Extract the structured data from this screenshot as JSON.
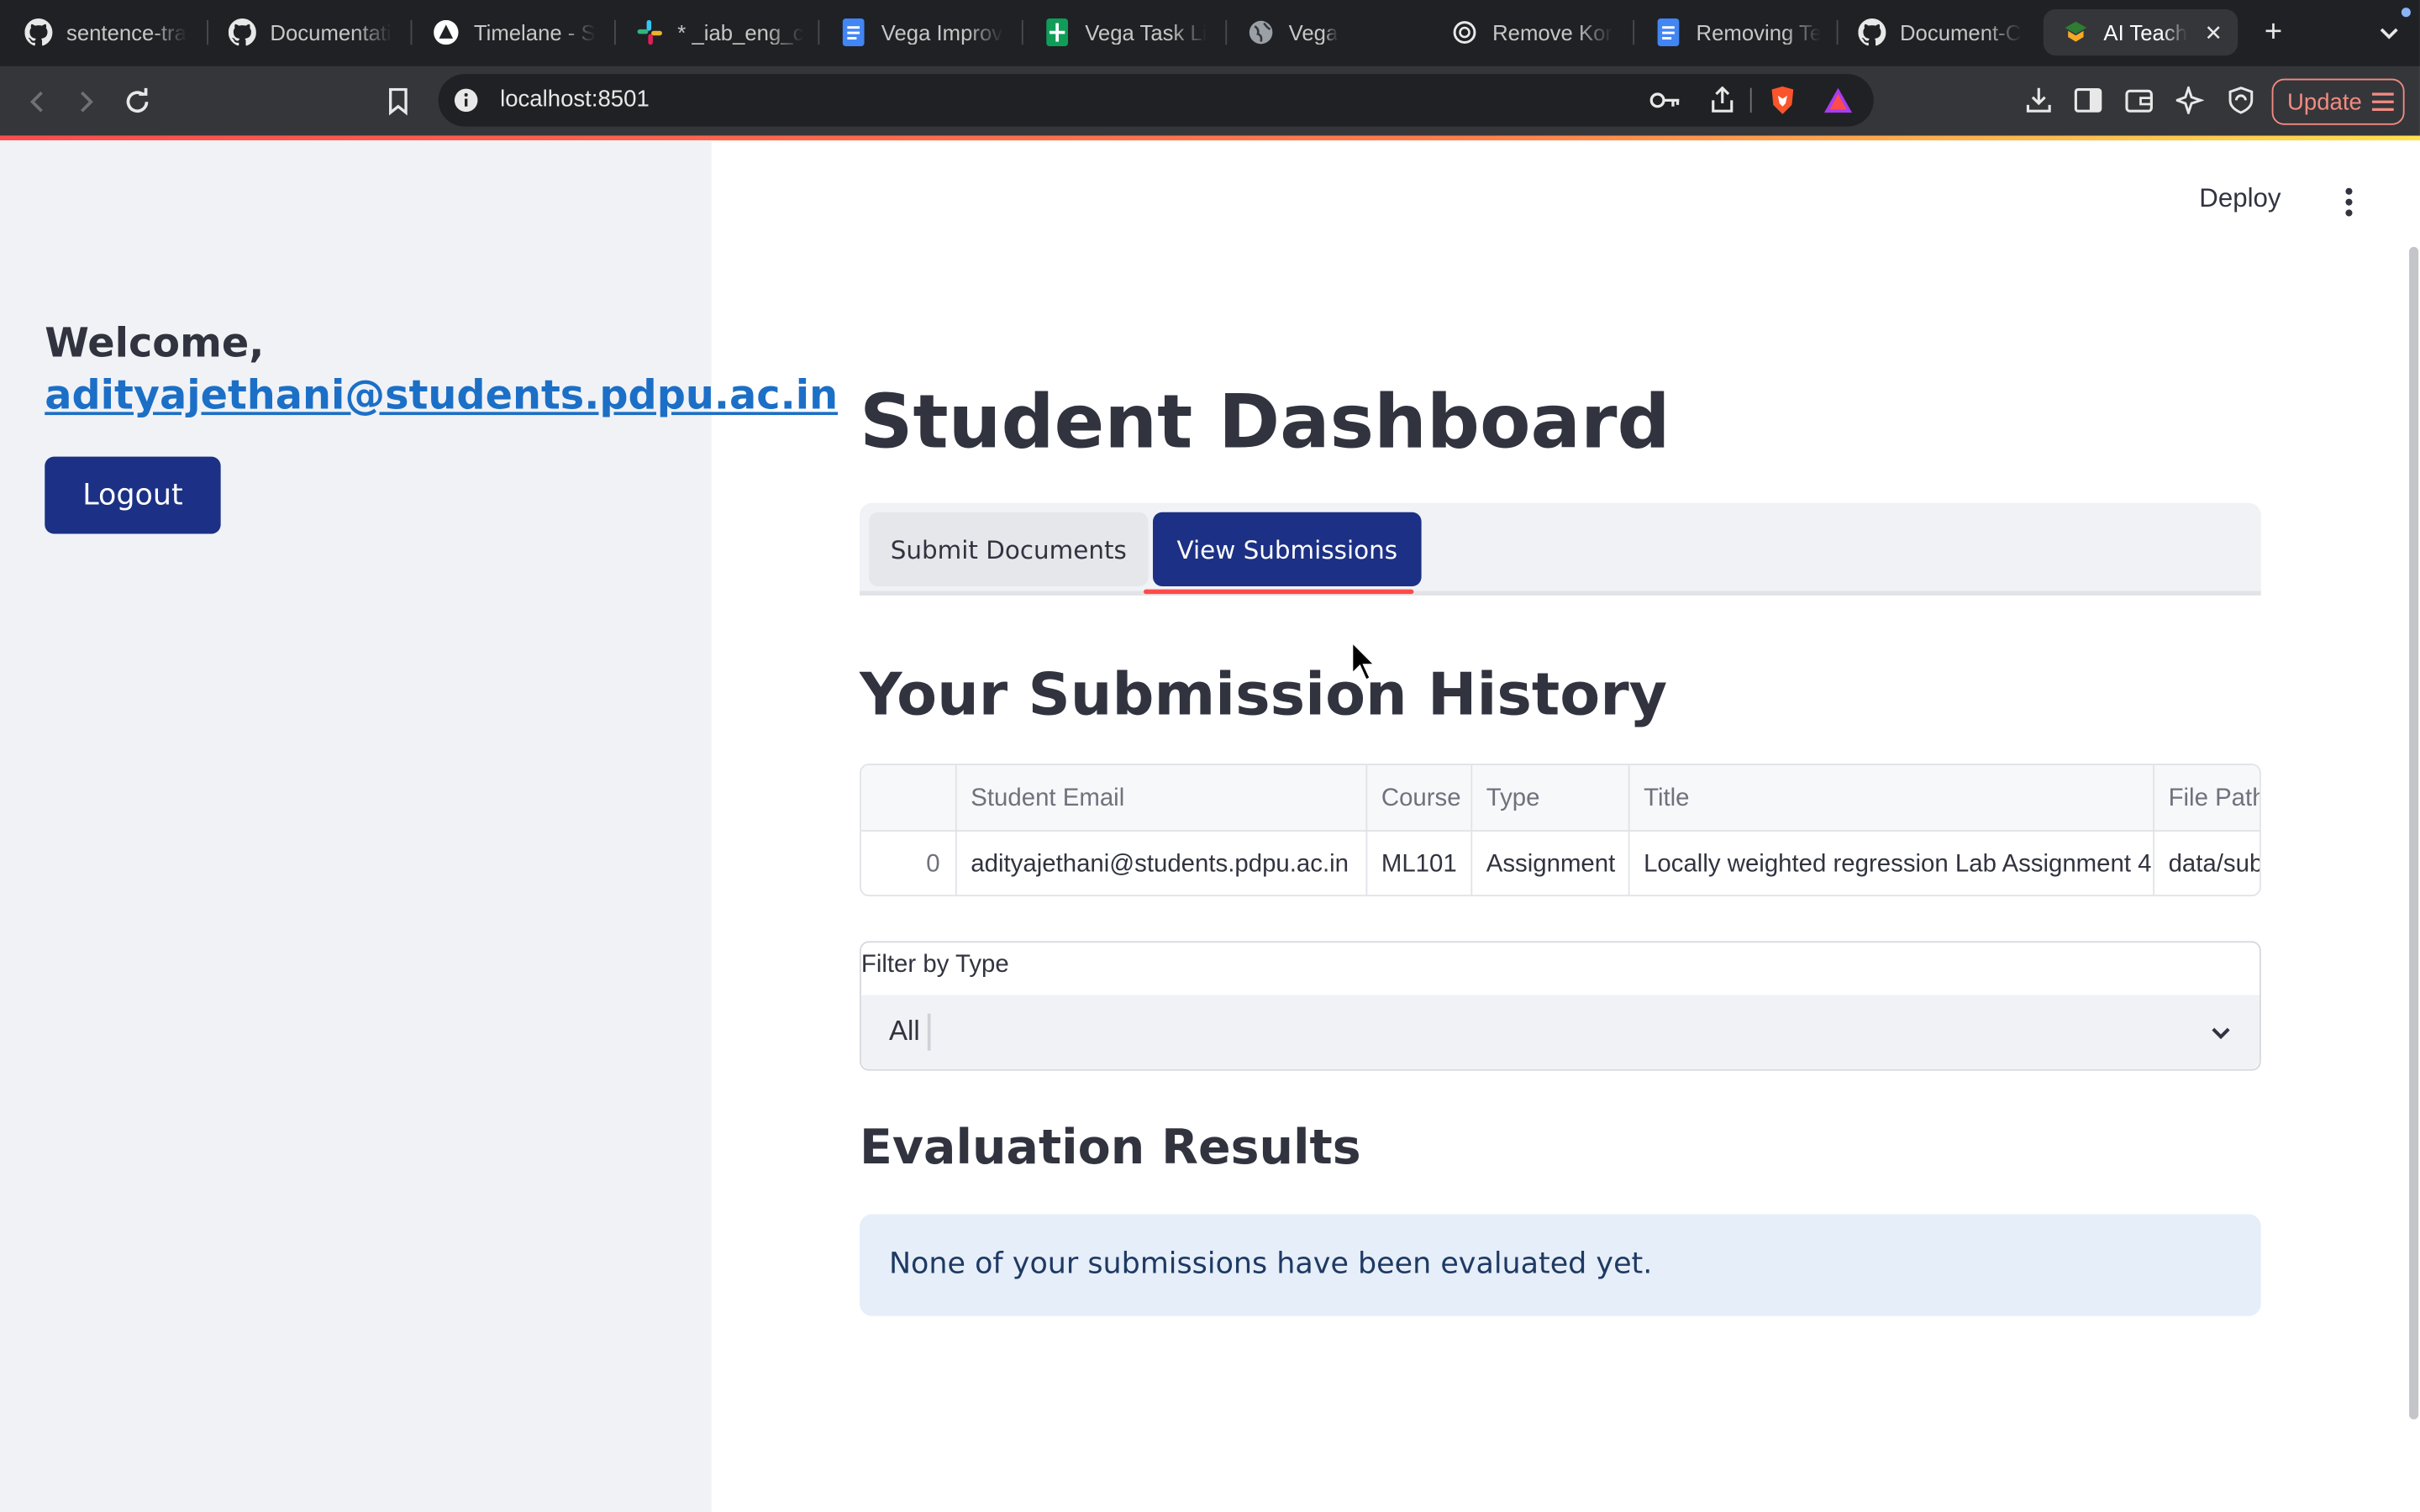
{
  "browser": {
    "tabs": [
      {
        "label": "sentence-tra",
        "icon": "github-icon"
      },
      {
        "label": "Documentati",
        "icon": "github-icon"
      },
      {
        "label": "Timelane - S",
        "icon": "timelane-icon"
      },
      {
        "label": "* _iab_eng_c",
        "icon": "slack-icon"
      },
      {
        "label": "Vega Improv",
        "icon": "google-docs-icon"
      },
      {
        "label": "Vega Task Li",
        "icon": "google-sheets-icon"
      },
      {
        "label": "Vega",
        "icon": "globe-icon"
      },
      {
        "label": "Remove Kor",
        "icon": "chatgpt-icon"
      },
      {
        "label": "Removing Te",
        "icon": "google-docs-icon"
      },
      {
        "label": "Document-C",
        "icon": "github-icon"
      },
      {
        "label": "AI Teach",
        "icon": "streamlit-icon",
        "active": true
      }
    ],
    "url": "localhost:8501",
    "update_label": "Update"
  },
  "sidebar": {
    "welcome": "Welcome,",
    "email": "adityajethani@students.pdpu.ac.in",
    "logout_label": "Logout"
  },
  "header": {
    "deploy_label": "Deploy"
  },
  "main": {
    "title": "Student Dashboard",
    "tabs": [
      {
        "label": "Submit Documents",
        "active": false
      },
      {
        "label": "View Submissions",
        "active": true
      }
    ],
    "history_title": "Your Submission History",
    "table": {
      "columns": [
        "",
        "Student Email",
        "Course",
        "Type",
        "Title",
        "File Path"
      ],
      "rows": [
        [
          "0",
          "adityajethani@students.pdpu.ac.in",
          "ML101",
          "Assignment",
          "Locally weighted regression Lab Assignment 4",
          "data/sub"
        ]
      ]
    },
    "filter": {
      "label": "Filter by Type",
      "value": "All"
    },
    "evaluation_title": "Evaluation Results",
    "evaluation_message": "None of your submissions have been evaluated yet."
  },
  "colors": {
    "primary": "#1c3185",
    "accent": "#ff4b4b",
    "link": "#1c6fc6",
    "sidebar_bg": "#f0f2f6",
    "info_bg": "#e6eef9"
  }
}
